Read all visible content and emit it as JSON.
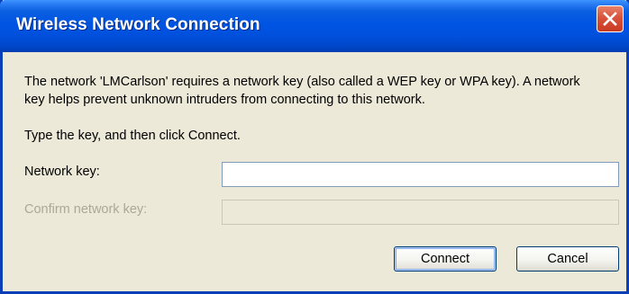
{
  "window": {
    "title": "Wireless Network Connection",
    "close_icon": "close-icon",
    "colors": {
      "titlebar": "#0054e3",
      "close_button": "#d8533a",
      "window_background": "#ece9d8",
      "disabled_text": "#aca899"
    }
  },
  "dialog": {
    "message": "The network 'LMCarlson' requires a network key (also called a WEP key or WPA key). A network key helps prevent unknown intruders from connecting to this network.",
    "instruction": "Type the key, and then click Connect.",
    "network_key": {
      "label": "Network key:",
      "value": ""
    },
    "confirm_key": {
      "label": "Confirm network key:",
      "value": "",
      "disabled": true
    },
    "buttons": {
      "connect": "Connect",
      "cancel": "Cancel"
    }
  }
}
